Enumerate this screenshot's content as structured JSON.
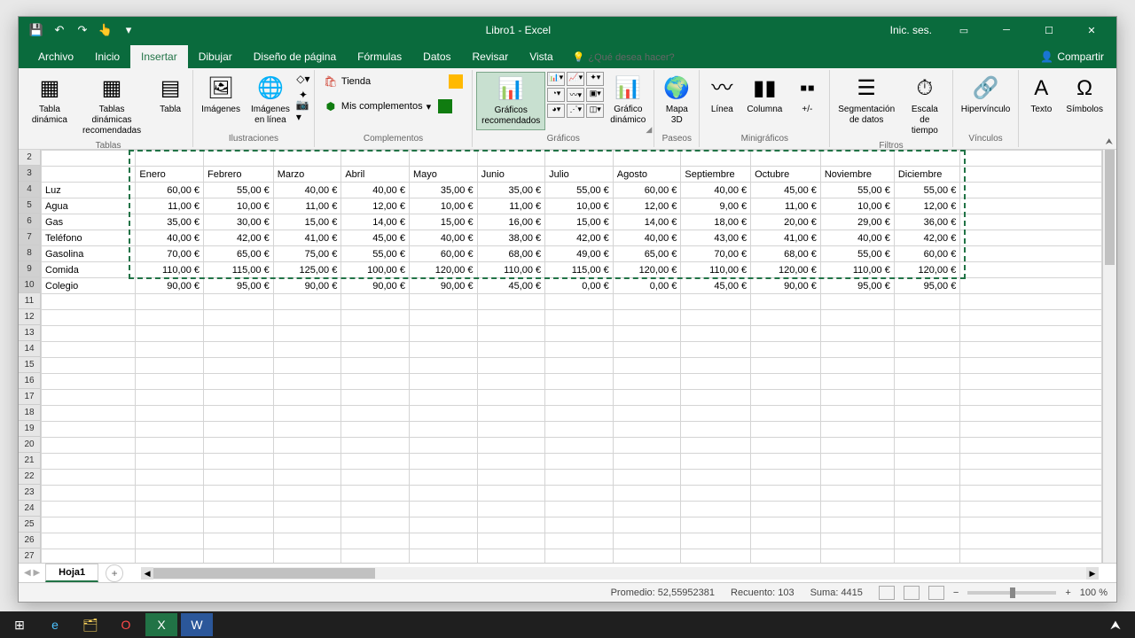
{
  "title": "Libro1 - Excel",
  "signin": "Inic. ses.",
  "tabs": {
    "file": "Archivo",
    "home": "Inicio",
    "insert": "Insertar",
    "draw": "Dibujar",
    "layout": "Diseño de página",
    "formulas": "Fórmulas",
    "data": "Datos",
    "review": "Revisar",
    "view": "Vista",
    "tellme": "¿Qué desea hacer?",
    "share": "Compartir"
  },
  "ribbon": {
    "tables": {
      "pivot": "Tabla\ndinámica",
      "recpivot": "Tablas dinámicas\nrecomendadas",
      "table": "Tabla",
      "group": "Tablas"
    },
    "illus": {
      "images": "Imágenes",
      "online": "Imágenes\nen línea",
      "group": "Ilustraciones"
    },
    "addins": {
      "store": "Tienda",
      "my": "Mis complementos",
      "group": "Complementos"
    },
    "charts": {
      "rec": "Gráficos\nrecomendados",
      "pivot": "Gráfico\ndinámico",
      "group": "Gráficos"
    },
    "tours": {
      "map3d": "Mapa\n3D",
      "group": "Paseos"
    },
    "spark": {
      "line": "Línea",
      "col": "Columna",
      "wl": "+/-",
      "group": "Minigráficos"
    },
    "filters": {
      "slicer": "Segmentación\nde datos",
      "timeline": "Escala de\ntiempo",
      "group": "Filtros"
    },
    "links": {
      "hyper": "Hipervínculo",
      "group": "Vínculos"
    },
    "text": {
      "text": "Texto",
      "symbols": "Símbolos"
    }
  },
  "months": [
    "Enero",
    "Febrero",
    "Marzo",
    "Abril",
    "Mayo",
    "Junio",
    "Julio",
    "Agosto",
    "Septiembre",
    "Octubre",
    "Noviembre",
    "Diciembre"
  ],
  "rows": [
    {
      "label": "Luz",
      "values": [
        "60,00 €",
        "55,00 €",
        "40,00 €",
        "40,00 €",
        "35,00 €",
        "35,00 €",
        "55,00 €",
        "60,00 €",
        "40,00 €",
        "45,00 €",
        "55,00 €",
        "55,00 €"
      ]
    },
    {
      "label": "Agua",
      "values": [
        "11,00 €",
        "10,00 €",
        "11,00 €",
        "12,00 €",
        "10,00 €",
        "11,00 €",
        "10,00 €",
        "12,00 €",
        "9,00 €",
        "11,00 €",
        "10,00 €",
        "12,00 €"
      ]
    },
    {
      "label": "Gas",
      "values": [
        "35,00 €",
        "30,00 €",
        "15,00 €",
        "14,00 €",
        "15,00 €",
        "16,00 €",
        "15,00 €",
        "14,00 €",
        "18,00 €",
        "20,00 €",
        "29,00 €",
        "36,00 €"
      ]
    },
    {
      "label": "Teléfono",
      "values": [
        "40,00 €",
        "42,00 €",
        "41,00 €",
        "45,00 €",
        "40,00 €",
        "38,00 €",
        "42,00 €",
        "40,00 €",
        "43,00 €",
        "41,00 €",
        "40,00 €",
        "42,00 €"
      ]
    },
    {
      "label": "Gasolina",
      "values": [
        "70,00 €",
        "65,00 €",
        "75,00 €",
        "55,00 €",
        "60,00 €",
        "68,00 €",
        "49,00 €",
        "65,00 €",
        "70,00 €",
        "68,00 €",
        "55,00 €",
        "60,00 €"
      ]
    },
    {
      "label": "Comida",
      "values": [
        "110,00 €",
        "115,00 €",
        "125,00 €",
        "100,00 €",
        "120,00 €",
        "110,00 €",
        "115,00 €",
        "120,00 €",
        "110,00 €",
        "120,00 €",
        "110,00 €",
        "120,00 €"
      ]
    },
    {
      "label": "Colegio",
      "values": [
        "90,00 €",
        "95,00 €",
        "90,00 €",
        "90,00 €",
        "90,00 €",
        "45,00 €",
        "0,00 €",
        "0,00 €",
        "45,00 €",
        "90,00 €",
        "95,00 €",
        "95,00 €"
      ]
    }
  ],
  "sheet": {
    "name": "Hoja1"
  },
  "status": {
    "avg": "Promedio: 52,55952381",
    "count": "Recuento: 103",
    "sum": "Suma: 4415",
    "zoom": "100 %"
  }
}
